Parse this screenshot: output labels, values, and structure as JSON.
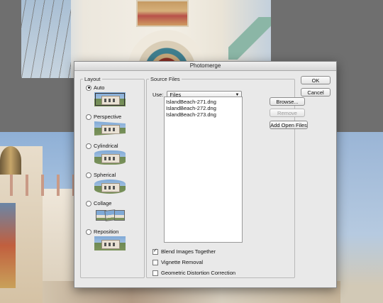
{
  "dialog": {
    "title": "Photomerge",
    "ok_label": "OK",
    "cancel_label": "Cancel"
  },
  "layout": {
    "legend": "Layout",
    "options": [
      {
        "label": "Auto",
        "selected": true
      },
      {
        "label": "Perspective",
        "selected": false
      },
      {
        "label": "Cylindrical",
        "selected": false
      },
      {
        "label": "Spherical",
        "selected": false
      },
      {
        "label": "Collage",
        "selected": false
      },
      {
        "label": "Reposition",
        "selected": false
      }
    ]
  },
  "source": {
    "legend": "Source Files",
    "use_label": "Use:",
    "use_value": "Files",
    "files": [
      "IslandBeach-271.dng",
      "IslandBeach-272.dng",
      "IslandBeach-273.dng"
    ],
    "browse_label": "Browse...",
    "remove_label": "Remove",
    "add_open_label": "Add Open Files"
  },
  "options": {
    "blend": {
      "label": "Blend Images Together",
      "checked": true
    },
    "vignette": {
      "label": "Vignette Removal",
      "checked": false
    },
    "distortion": {
      "label": "Geometric Distortion Correction",
      "checked": false
    }
  },
  "colors": {
    "dialog_bg": "#e9e9e9",
    "background": "#6f6f6f"
  }
}
